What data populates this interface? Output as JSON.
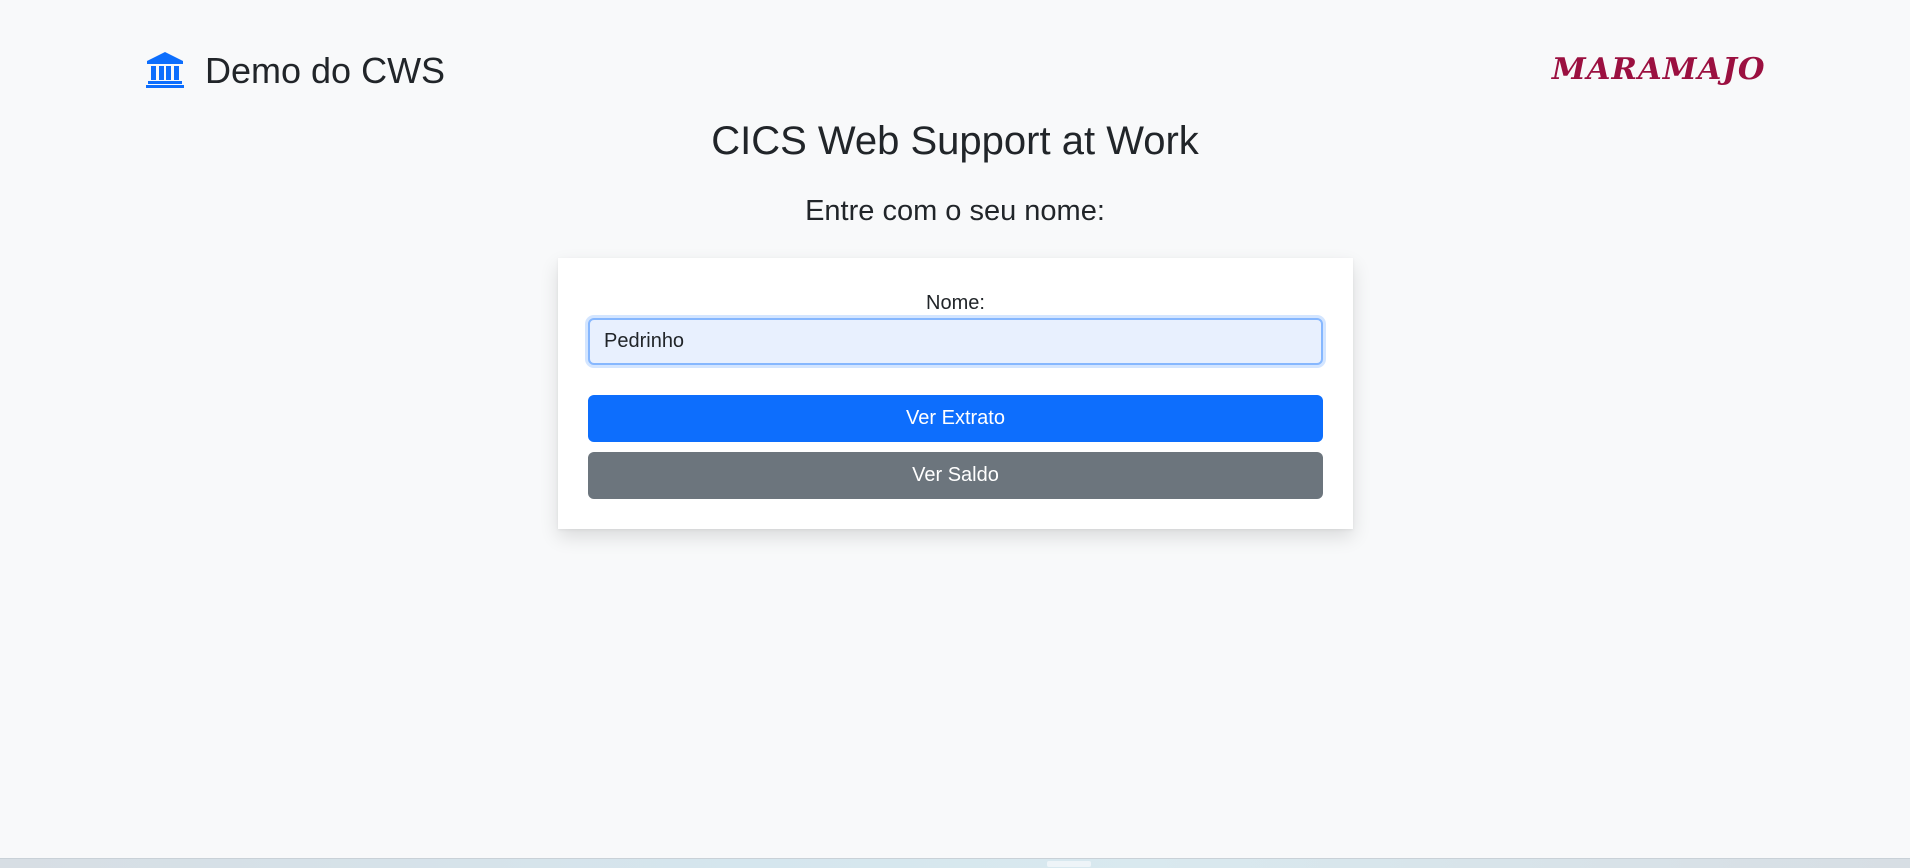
{
  "header": {
    "app_title": "Demo do CWS",
    "icon": "bank-icon",
    "logo_text": "MARAMAJO"
  },
  "main": {
    "title": "CICS Web Support at Work",
    "subtitle": "Entre com o seu nome:"
  },
  "form": {
    "name_label": "Nome:",
    "name_value": "Pedrinho",
    "extrato_button": "Ver Extrato",
    "saldo_button": "Ver Saldo"
  },
  "colors": {
    "primary": "#0d6efd",
    "secondary": "#6c757d",
    "logo": "#9b1040",
    "background": "#f8f9fa"
  }
}
